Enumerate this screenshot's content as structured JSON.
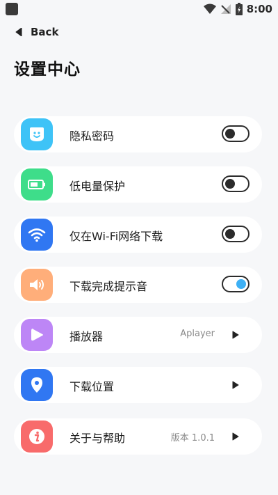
{
  "status_bar": {
    "time": "8:00"
  },
  "nav": {
    "back_label": "Back"
  },
  "page": {
    "title": "设置中心"
  },
  "settings": [
    {
      "label": "隐私密码",
      "icon": "face-icon",
      "color": "#3ec3f7",
      "toggle": false
    },
    {
      "label": "低电量保护",
      "icon": "battery-icon",
      "color": "#3edd8a",
      "toggle": false
    },
    {
      "label": "仅在Wi-Fi网络下载",
      "icon": "wifi-icon",
      "color": "#3077f2",
      "toggle": false
    },
    {
      "label": "下载完成提示音",
      "icon": "speaker-icon",
      "color": "#ffae7a",
      "toggle": true
    },
    {
      "label": "播放器",
      "icon": "play-icon",
      "color": "#bd86f6",
      "value": "Aplayer"
    },
    {
      "label": "下载位置",
      "icon": "location-pin-icon",
      "color": "#3077f2"
    },
    {
      "label": "关于与帮助",
      "icon": "info-icon",
      "color": "#f86b6b",
      "value": "版本 1.0.1"
    }
  ]
}
